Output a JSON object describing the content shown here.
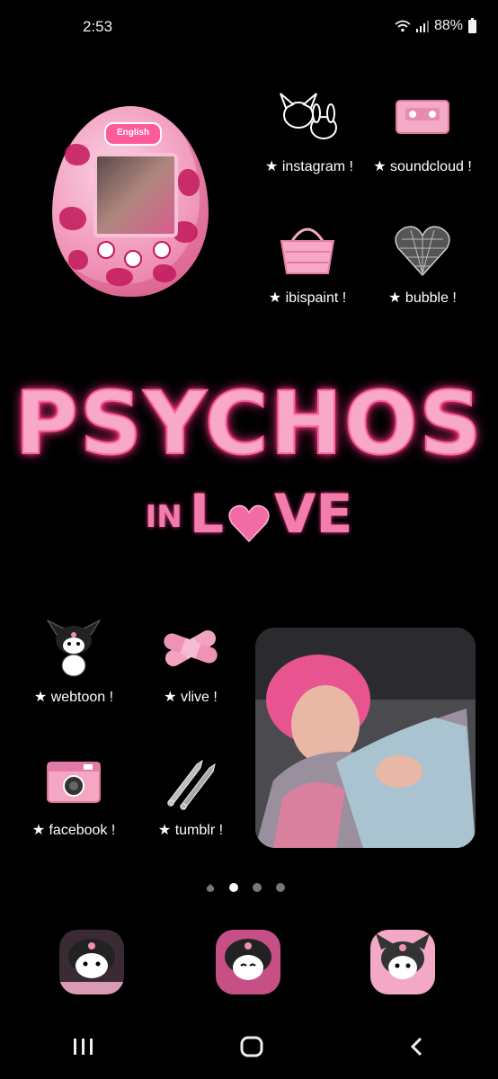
{
  "status_bar": {
    "time": "2:53",
    "battery": "88%"
  },
  "apps": {
    "instagram": "★ instagram !",
    "soundcloud": "★ soundcloud !",
    "ibispaint": "★ ibispaint !",
    "bubble": "★ bubble !",
    "webtoon": "★ webtoon !",
    "vlive": "★ vlive !",
    "facebook": "★ facebook !",
    "tumblr": "★ tumblr !"
  },
  "title_art": {
    "line1": "PSYCHOS",
    "line2_left": "IN",
    "line2_right": "VE",
    "line2_l": "L"
  },
  "tamagotchi_logo": "English",
  "page_indicator": {
    "pages": 4,
    "active": 1
  },
  "colors": {
    "accent": "#ff5fa0",
    "background": "#000000"
  }
}
